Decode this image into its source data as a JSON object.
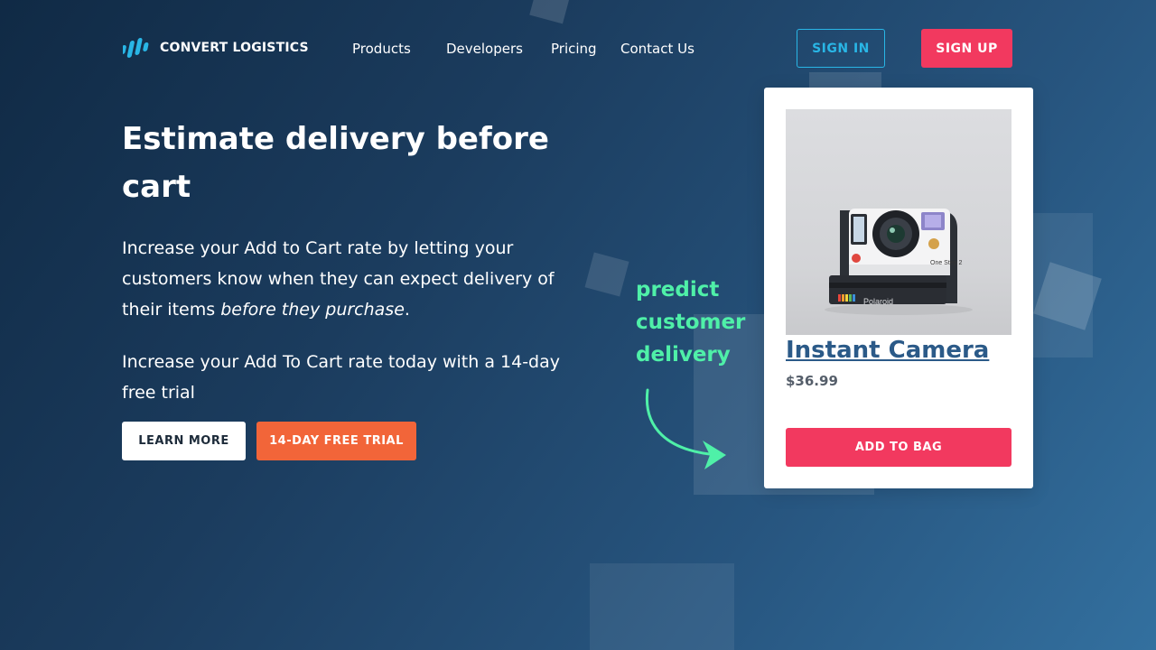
{
  "brand": {
    "name": "CONVERT LOGISTICS",
    "logo_icon": "bars-logo-icon",
    "accent": "#29b6e6"
  },
  "nav": {
    "items": [
      {
        "label": "Products"
      },
      {
        "label": "Developers"
      },
      {
        "label": "Pricing"
      },
      {
        "label": "Contact Us"
      }
    ]
  },
  "auth": {
    "sign_in": "SIGN IN",
    "sign_up": "SIGN UP",
    "sign_in_color": "#29b6e6",
    "sign_up_color": "#f2395f"
  },
  "hero": {
    "title": "Estimate delivery before cart",
    "p1_text": "Increase your Add to Cart rate by letting your customers know when they can expect delivery of their items ",
    "p1_emph": "before they purchase",
    "p1_end": ".",
    "p2": "Increase your Add To Cart rate today with a 14-day free trial",
    "learn_more": "LEARN MORE",
    "free_trial": "14-DAY FREE TRIAL",
    "trial_color": "#f26539"
  },
  "annotation": {
    "text": "predict customer delivery",
    "color": "#4ff0a8",
    "icon": "curved-arrow-icon"
  },
  "product": {
    "name": "Instant Camera",
    "price": "$36.99",
    "cta": "ADD TO BAG",
    "image_icon": "camera-photo",
    "camera_brand": "Polaroid",
    "camera_model": "One Step 2"
  }
}
